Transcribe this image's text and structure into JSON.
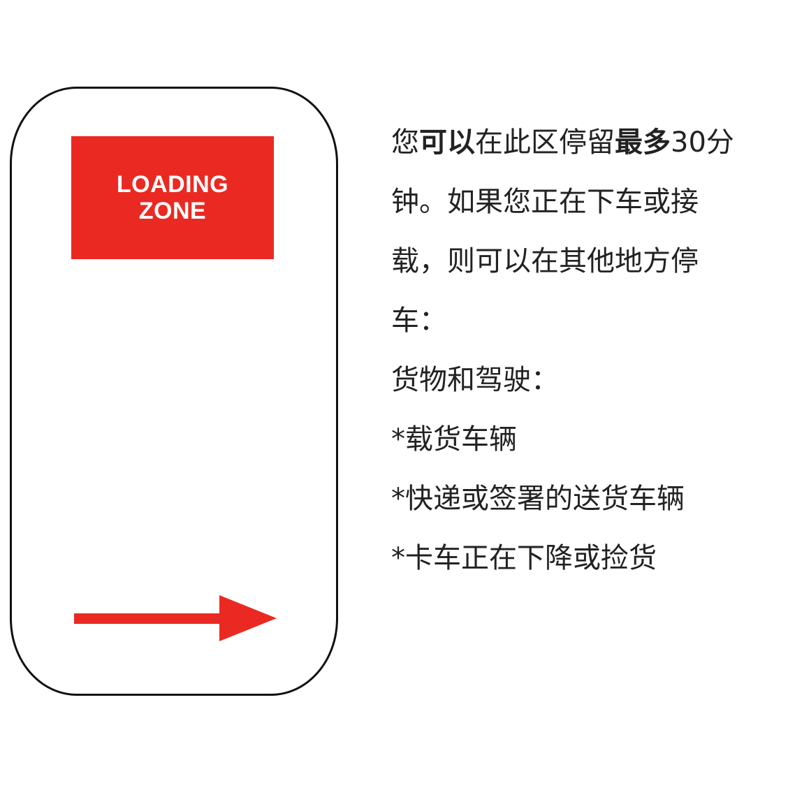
{
  "sign": {
    "zone_line1": "LOADING",
    "zone_line2": "ZONE",
    "arrow_icon": "right-arrow-icon",
    "colors": {
      "red": "#ea2a22",
      "border": "#111111"
    }
  },
  "info": {
    "line1": {
      "p1": "您",
      "b1": "可以",
      "p2": "在此区停留",
      "b2": "最多",
      "p3": "30分"
    },
    "line2": "钟。如果您正在下车或接",
    "line3": "载，则可以在其他地方停",
    "line4": "车：",
    "line5": "货物和驾驶：",
    "line6": "*载货车辆",
    "line7": "*快递或签署的送货车辆",
    "line8": "*卡车正在下降或捡货"
  }
}
